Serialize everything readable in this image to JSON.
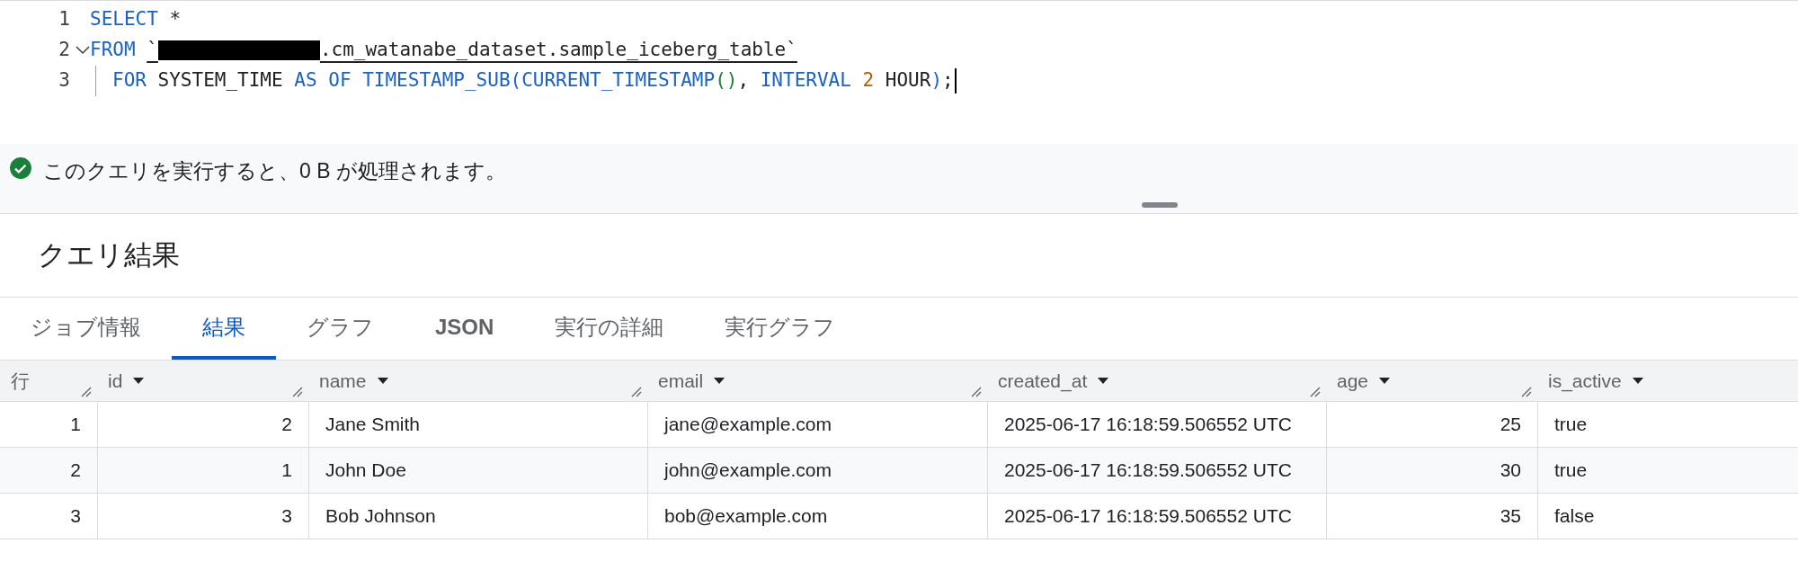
{
  "editor": {
    "lines": [
      {
        "number": "1",
        "foldable": false,
        "guide": false,
        "cursor": false,
        "tokens": [
          {
            "kind": "keyword",
            "text": "SELECT"
          },
          {
            "kind": "plain",
            "text": " *"
          }
        ]
      },
      {
        "number": "2",
        "foldable": true,
        "guide": false,
        "cursor": false,
        "tokens": [
          {
            "kind": "keyword",
            "text": "FROM "
          },
          {
            "kind": "reference",
            "text": "`"
          },
          {
            "kind": "redacted"
          },
          {
            "kind": "reference",
            "text": ".cm_watanabe_dataset.sample_iceberg_table`"
          }
        ]
      },
      {
        "number": "3",
        "foldable": false,
        "guide": true,
        "cursor": true,
        "tokens": [
          {
            "kind": "keyword",
            "text": "FOR"
          },
          {
            "kind": "plain",
            "text": " SYSTEM_TIME "
          },
          {
            "kind": "keyword",
            "text": "AS OF TIMESTAMP_SUB"
          },
          {
            "kind": "keyword",
            "text": "("
          },
          {
            "kind": "keyword",
            "text": "CURRENT_TIMESTAMP"
          },
          {
            "kind": "paren",
            "text": "()"
          },
          {
            "kind": "plain",
            "text": ", "
          },
          {
            "kind": "keyword",
            "text": "INTERVAL "
          },
          {
            "kind": "number",
            "text": "2"
          },
          {
            "kind": "plain",
            "text": " HOUR"
          },
          {
            "kind": "keyword",
            "text": ")"
          },
          {
            "kind": "plain",
            "text": ";"
          }
        ]
      }
    ]
  },
  "validation": {
    "kind": "ok",
    "message": "このクエリを実行すると、0 B が処理されます。"
  },
  "results": {
    "title": "クエリ結果",
    "tabs": [
      {
        "label": "ジョブ情報",
        "selected": false
      },
      {
        "label": "結果",
        "selected": true
      },
      {
        "label": "グラフ",
        "selected": false
      },
      {
        "label": "JSON",
        "selected": false
      },
      {
        "label": "実行の詳細",
        "selected": false
      },
      {
        "label": "実行グラフ",
        "selected": false
      }
    ],
    "table": {
      "columns": [
        {
          "label": "行",
          "kind": "rownum"
        },
        {
          "label": "id",
          "kind": "number"
        },
        {
          "label": "name",
          "kind": "text"
        },
        {
          "label": "email",
          "kind": "text"
        },
        {
          "label": "created_at",
          "kind": "text"
        },
        {
          "label": "age",
          "kind": "number"
        },
        {
          "label": "is_active",
          "kind": "text"
        }
      ],
      "rows": [
        [
          "1",
          "2",
          "Jane Smith",
          "jane@example.com",
          "2025-06-17 16:18:59.506552 UTC",
          "25",
          "true"
        ],
        [
          "2",
          "1",
          "John Doe",
          "john@example.com",
          "2025-06-17 16:18:59.506552 UTC",
          "30",
          "true"
        ],
        [
          "3",
          "3",
          "Bob Johnson",
          "bob@example.com",
          "2025-06-17 16:18:59.506552 UTC",
          "35",
          "false"
        ]
      ]
    }
  }
}
